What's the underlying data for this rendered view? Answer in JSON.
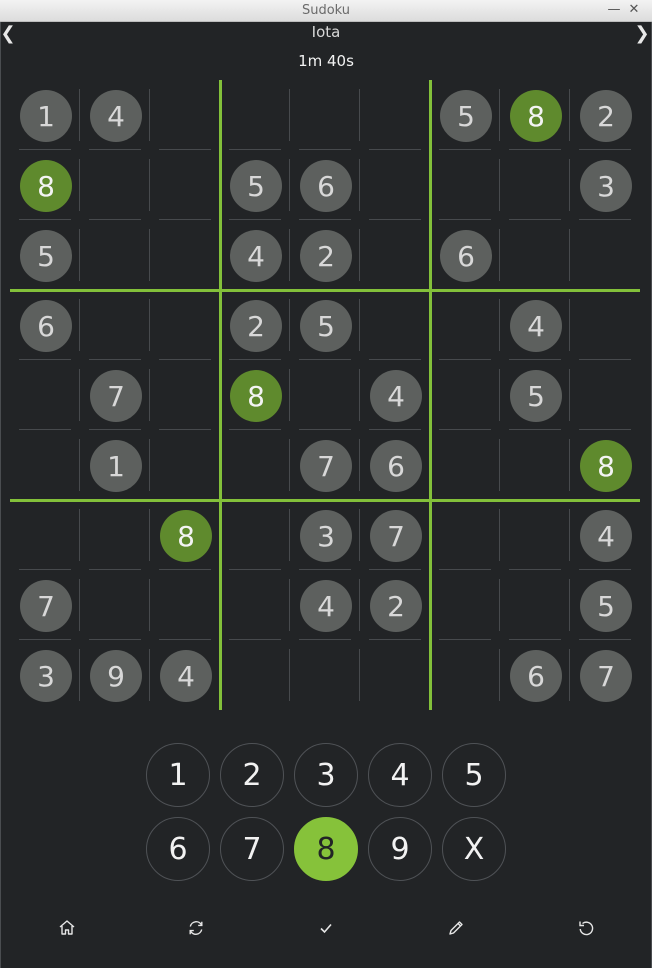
{
  "window": {
    "title": "Sudoku"
  },
  "puzzle": {
    "name": "Iota",
    "timer": "1m 40s"
  },
  "highlight_digit": "8",
  "board": [
    [
      "1",
      "4",
      "",
      "",
      "",
      "",
      "5",
      "8",
      "2"
    ],
    [
      "8",
      "",
      "",
      "5",
      "6",
      "",
      "",
      "",
      "3"
    ],
    [
      "5",
      "",
      "",
      "4",
      "2",
      "",
      "6",
      "",
      ""
    ],
    [
      "6",
      "",
      "",
      "2",
      "5",
      "",
      "",
      "4",
      ""
    ],
    [
      "",
      "7",
      "",
      "8",
      "",
      "4",
      "",
      "5",
      ""
    ],
    [
      "",
      "1",
      "",
      "",
      "7",
      "6",
      "",
      "",
      "8"
    ],
    [
      "",
      "",
      "8",
      "",
      "3",
      "7",
      "",
      "",
      "4"
    ],
    [
      "7",
      "",
      "",
      "",
      "4",
      "2",
      "",
      "",
      "5"
    ],
    [
      "3",
      "9",
      "4",
      "",
      "",
      "",
      "",
      "6",
      "7"
    ]
  ],
  "keypad": {
    "row1": [
      "1",
      "2",
      "3",
      "4",
      "5"
    ],
    "row2": [
      "6",
      "7",
      "8",
      "9",
      "X"
    ],
    "selected": "8"
  },
  "toolbar": [
    "home-icon",
    "refresh-icon",
    "check-icon",
    "pencil-icon",
    "undo-icon"
  ],
  "colors": {
    "accent": "#86c23a",
    "highlight_cell": "#5f8a2d",
    "given_cell": "#5d605e",
    "background": "#222426"
  }
}
